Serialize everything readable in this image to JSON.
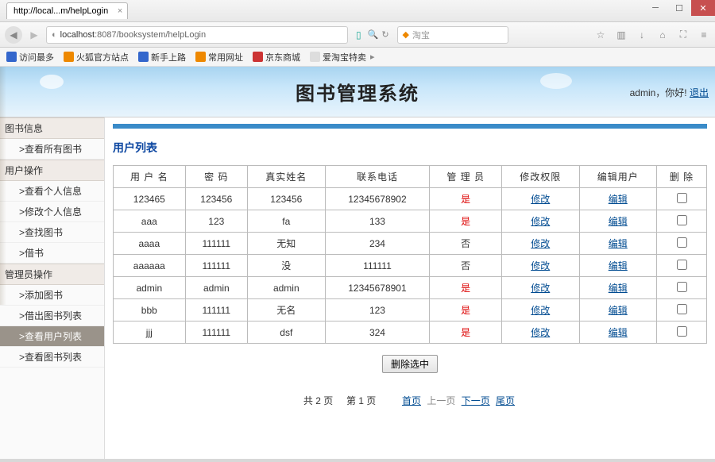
{
  "browser": {
    "tab_title": "http://local...m/helpLogin",
    "url_prefix": "localhost",
    "url_port": ":8087",
    "url_path": "/booksystem/helpLogin",
    "search_placeholder": "淘宝",
    "bookmarks": [
      "访问最多",
      "火狐官方站点",
      "新手上路",
      "常用网址",
      "京东商城",
      "爱淘宝特卖"
    ]
  },
  "header": {
    "system_title": "图书管理系统",
    "greeting_user": "admin",
    "greeting_suffix": "，你好!",
    "logout": "退出"
  },
  "sidebar": {
    "groups": [
      {
        "title": "图书信息",
        "items": [
          ">查看所有图书"
        ]
      },
      {
        "title": "用户操作",
        "items": [
          ">查看个人信息",
          ">修改个人信息",
          ">查找图书",
          ">借书"
        ]
      },
      {
        "title": "管理员操作",
        "items": [
          ">添加图书",
          ">借出图书列表",
          ">查看用户列表",
          ">查看图书列表"
        ]
      }
    ],
    "active": ">查看用户列表"
  },
  "content": {
    "list_title": "用户列表",
    "columns": [
      "用 户 名",
      "密  码",
      "真实姓名",
      "联系电话",
      "管 理 员",
      "修改权限",
      "编辑用户",
      "删  除"
    ],
    "rows": [
      {
        "username": "123465",
        "password": "123456",
        "realname": "123456",
        "phone": "12345678902",
        "admin": "是",
        "modify": "修改",
        "edit": "编辑"
      },
      {
        "username": "aaa",
        "password": "123",
        "realname": "fa",
        "phone": "133",
        "admin": "是",
        "modify": "修改",
        "edit": "编辑"
      },
      {
        "username": "aaaa",
        "password": "111111",
        "realname": "无知",
        "phone": "234",
        "admin": "否",
        "modify": "修改",
        "edit": "编辑"
      },
      {
        "username": "aaaaaa",
        "password": "111111",
        "realname": "没",
        "phone": "111111",
        "admin": "否",
        "modify": "修改",
        "edit": "编辑"
      },
      {
        "username": "admin",
        "password": "admin",
        "realname": "admin",
        "phone": "12345678901",
        "admin": "是",
        "modify": "修改",
        "edit": "编辑"
      },
      {
        "username": "bbb",
        "password": "111111",
        "realname": "无名",
        "phone": "123",
        "admin": "是",
        "modify": "修改",
        "edit": "编辑"
      },
      {
        "username": "jjj",
        "password": "111111",
        "realname": "dsf",
        "phone": "324",
        "admin": "是",
        "modify": "修改",
        "edit": "编辑"
      }
    ],
    "delete_selected": "删除选中",
    "pagination": {
      "total_pages_label": "共 2 页",
      "current_page_label": "第 1 页",
      "first": "首页",
      "prev": "上一页",
      "next": "下一页",
      "last": "尾页"
    }
  }
}
